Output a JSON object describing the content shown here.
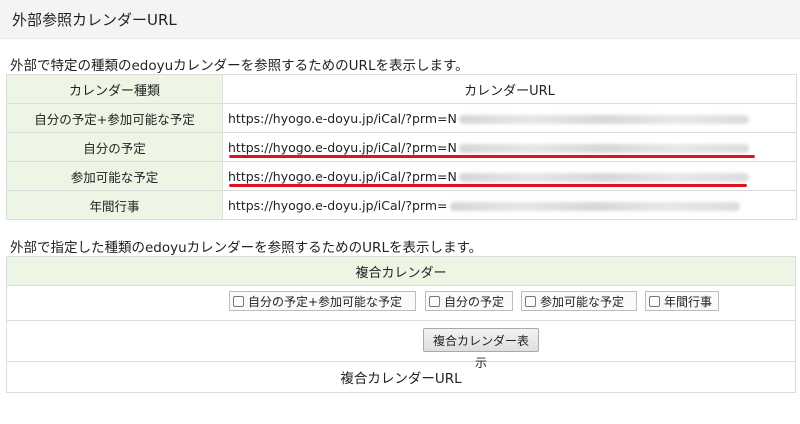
{
  "page": {
    "title": "外部参照カレンダーURL"
  },
  "section1": {
    "description": "外部で特定の種類のedoyuカレンダーを参照するためのURLを表示します。",
    "header_type": "カレンダー種類",
    "header_url": "カレンダーURL",
    "rows": [
      {
        "label": "自分の予定+参加可能な予定",
        "url": "https://hyogo.e-doyu.jp/iCal/?prm=N"
      },
      {
        "label": "自分の予定",
        "url": "https://hyogo.e-doyu.jp/iCal/?prm=N"
      },
      {
        "label": "参加可能な予定",
        "url": "https://hyogo.e-doyu.jp/iCal/?prm=N"
      },
      {
        "label": "年間行事",
        "url": "https://hyogo.e-doyu.jp/iCal/?prm="
      }
    ]
  },
  "section2": {
    "description": "外部で指定した種類のedoyuカレンダーを参照するためのURLを表示します。",
    "header": "複合カレンダー",
    "options": [
      "自分の予定+参加可能な予定",
      "自分の予定",
      "参加可能な予定",
      "年間行事"
    ],
    "button_label": "複合カレンダー表示",
    "url_label": "複合カレンダーURL"
  },
  "colors": {
    "accent_red": "#e0141e",
    "header_green": "#edf5e4"
  }
}
